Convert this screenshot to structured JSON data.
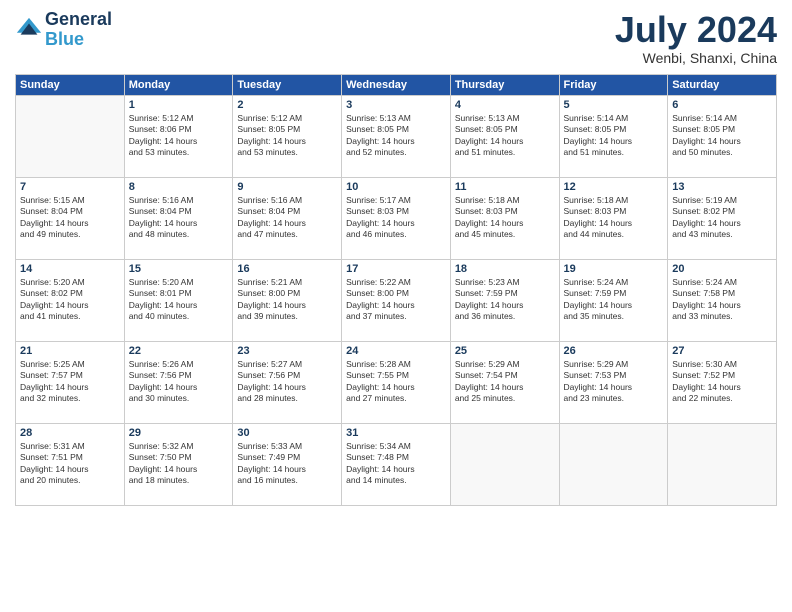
{
  "header": {
    "logo_line1": "General",
    "logo_line2": "Blue",
    "month": "July 2024",
    "location": "Wenbi, Shanxi, China"
  },
  "weekdays": [
    "Sunday",
    "Monday",
    "Tuesday",
    "Wednesday",
    "Thursday",
    "Friday",
    "Saturday"
  ],
  "weeks": [
    [
      {
        "day": "",
        "text": ""
      },
      {
        "day": "1",
        "text": "Sunrise: 5:12 AM\nSunset: 8:06 PM\nDaylight: 14 hours\nand 53 minutes."
      },
      {
        "day": "2",
        "text": "Sunrise: 5:12 AM\nSunset: 8:05 PM\nDaylight: 14 hours\nand 53 minutes."
      },
      {
        "day": "3",
        "text": "Sunrise: 5:13 AM\nSunset: 8:05 PM\nDaylight: 14 hours\nand 52 minutes."
      },
      {
        "day": "4",
        "text": "Sunrise: 5:13 AM\nSunset: 8:05 PM\nDaylight: 14 hours\nand 51 minutes."
      },
      {
        "day": "5",
        "text": "Sunrise: 5:14 AM\nSunset: 8:05 PM\nDaylight: 14 hours\nand 51 minutes."
      },
      {
        "day": "6",
        "text": "Sunrise: 5:14 AM\nSunset: 8:05 PM\nDaylight: 14 hours\nand 50 minutes."
      }
    ],
    [
      {
        "day": "7",
        "text": "Sunrise: 5:15 AM\nSunset: 8:04 PM\nDaylight: 14 hours\nand 49 minutes."
      },
      {
        "day": "8",
        "text": "Sunrise: 5:16 AM\nSunset: 8:04 PM\nDaylight: 14 hours\nand 48 minutes."
      },
      {
        "day": "9",
        "text": "Sunrise: 5:16 AM\nSunset: 8:04 PM\nDaylight: 14 hours\nand 47 minutes."
      },
      {
        "day": "10",
        "text": "Sunrise: 5:17 AM\nSunset: 8:03 PM\nDaylight: 14 hours\nand 46 minutes."
      },
      {
        "day": "11",
        "text": "Sunrise: 5:18 AM\nSunset: 8:03 PM\nDaylight: 14 hours\nand 45 minutes."
      },
      {
        "day": "12",
        "text": "Sunrise: 5:18 AM\nSunset: 8:03 PM\nDaylight: 14 hours\nand 44 minutes."
      },
      {
        "day": "13",
        "text": "Sunrise: 5:19 AM\nSunset: 8:02 PM\nDaylight: 14 hours\nand 43 minutes."
      }
    ],
    [
      {
        "day": "14",
        "text": "Sunrise: 5:20 AM\nSunset: 8:02 PM\nDaylight: 14 hours\nand 41 minutes."
      },
      {
        "day": "15",
        "text": "Sunrise: 5:20 AM\nSunset: 8:01 PM\nDaylight: 14 hours\nand 40 minutes."
      },
      {
        "day": "16",
        "text": "Sunrise: 5:21 AM\nSunset: 8:00 PM\nDaylight: 14 hours\nand 39 minutes."
      },
      {
        "day": "17",
        "text": "Sunrise: 5:22 AM\nSunset: 8:00 PM\nDaylight: 14 hours\nand 37 minutes."
      },
      {
        "day": "18",
        "text": "Sunrise: 5:23 AM\nSunset: 7:59 PM\nDaylight: 14 hours\nand 36 minutes."
      },
      {
        "day": "19",
        "text": "Sunrise: 5:24 AM\nSunset: 7:59 PM\nDaylight: 14 hours\nand 35 minutes."
      },
      {
        "day": "20",
        "text": "Sunrise: 5:24 AM\nSunset: 7:58 PM\nDaylight: 14 hours\nand 33 minutes."
      }
    ],
    [
      {
        "day": "21",
        "text": "Sunrise: 5:25 AM\nSunset: 7:57 PM\nDaylight: 14 hours\nand 32 minutes."
      },
      {
        "day": "22",
        "text": "Sunrise: 5:26 AM\nSunset: 7:56 PM\nDaylight: 14 hours\nand 30 minutes."
      },
      {
        "day": "23",
        "text": "Sunrise: 5:27 AM\nSunset: 7:56 PM\nDaylight: 14 hours\nand 28 minutes."
      },
      {
        "day": "24",
        "text": "Sunrise: 5:28 AM\nSunset: 7:55 PM\nDaylight: 14 hours\nand 27 minutes."
      },
      {
        "day": "25",
        "text": "Sunrise: 5:29 AM\nSunset: 7:54 PM\nDaylight: 14 hours\nand 25 minutes."
      },
      {
        "day": "26",
        "text": "Sunrise: 5:29 AM\nSunset: 7:53 PM\nDaylight: 14 hours\nand 23 minutes."
      },
      {
        "day": "27",
        "text": "Sunrise: 5:30 AM\nSunset: 7:52 PM\nDaylight: 14 hours\nand 22 minutes."
      }
    ],
    [
      {
        "day": "28",
        "text": "Sunrise: 5:31 AM\nSunset: 7:51 PM\nDaylight: 14 hours\nand 20 minutes."
      },
      {
        "day": "29",
        "text": "Sunrise: 5:32 AM\nSunset: 7:50 PM\nDaylight: 14 hours\nand 18 minutes."
      },
      {
        "day": "30",
        "text": "Sunrise: 5:33 AM\nSunset: 7:49 PM\nDaylight: 14 hours\nand 16 minutes."
      },
      {
        "day": "31",
        "text": "Sunrise: 5:34 AM\nSunset: 7:48 PM\nDaylight: 14 hours\nand 14 minutes."
      },
      {
        "day": "",
        "text": ""
      },
      {
        "day": "",
        "text": ""
      },
      {
        "day": "",
        "text": ""
      }
    ]
  ]
}
